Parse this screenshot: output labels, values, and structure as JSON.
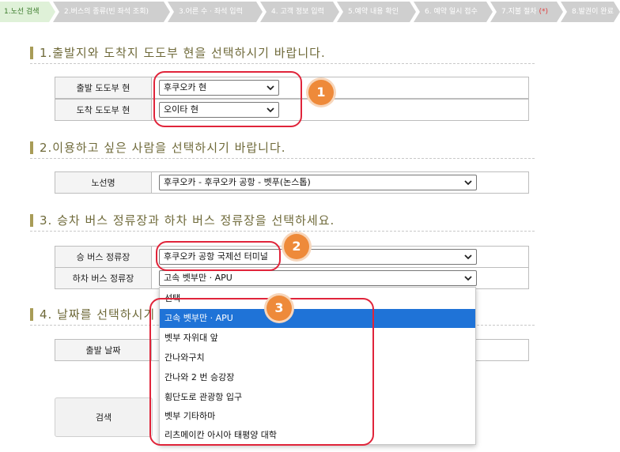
{
  "steps": [
    "1.노선 검색",
    "2.버스의 종류(빈 좌석 조회)",
    "3.어른 수 · 좌석 입력",
    "4. 고객 정보 입력",
    "5.예약 내용 확인",
    "6. 예약 일시 접수",
    "7.지불 절차",
    "8.발권이 완료"
  ],
  "step7_mark": "(*)",
  "section1": {
    "title": "1.출발지와 도착지 도도부 현을 선택하시기 바랍니다.",
    "departure_label": "출발 도도부 현",
    "departure_value": "후쿠오카 현",
    "arrival_label": "도착 도도부 현",
    "arrival_value": "오이타 현"
  },
  "section2": {
    "title": "2.이용하고 싶은 사람을 선택하시기 바랍니다.",
    "route_label": "노선명",
    "route_value": "후쿠오카 - 후쿠오카 공항 - 벳푸(논스톱)"
  },
  "section3": {
    "title": "3. 승차 버스 정류장과 하차 버스 정류장을 선택하세요.",
    "board_label": "승 버스 정류장",
    "board_value": "후쿠오카 공항 국제선 터미널",
    "alight_label": "하차 버스 정류장",
    "alight_value": "고속 벳부만 · APU"
  },
  "section4": {
    "title": "4. 날짜를 선택하시기",
    "date_label": "출발 날짜"
  },
  "search_label": "검색",
  "dropdown_options": [
    "선택",
    "고속 벳부만 · APU",
    "벳부 자위대 앞",
    "간나와구치",
    "간나와 2 번 승강장",
    "횡단도로 관광항 입구",
    "벳부 기타하마",
    "리츠메이칸 아시아 태평양 대학"
  ],
  "dropdown_selected_index": 1,
  "badges": [
    "1",
    "2",
    "3"
  ],
  "colors": {
    "active_step_bg": "#dff1d8",
    "step_bg": "#cfcfcf",
    "heading_text": "#6f6a3a",
    "callout_ring": "#e0243a",
    "badge_orange": "#ee8a3a",
    "selected_option": "#1f73d7"
  }
}
